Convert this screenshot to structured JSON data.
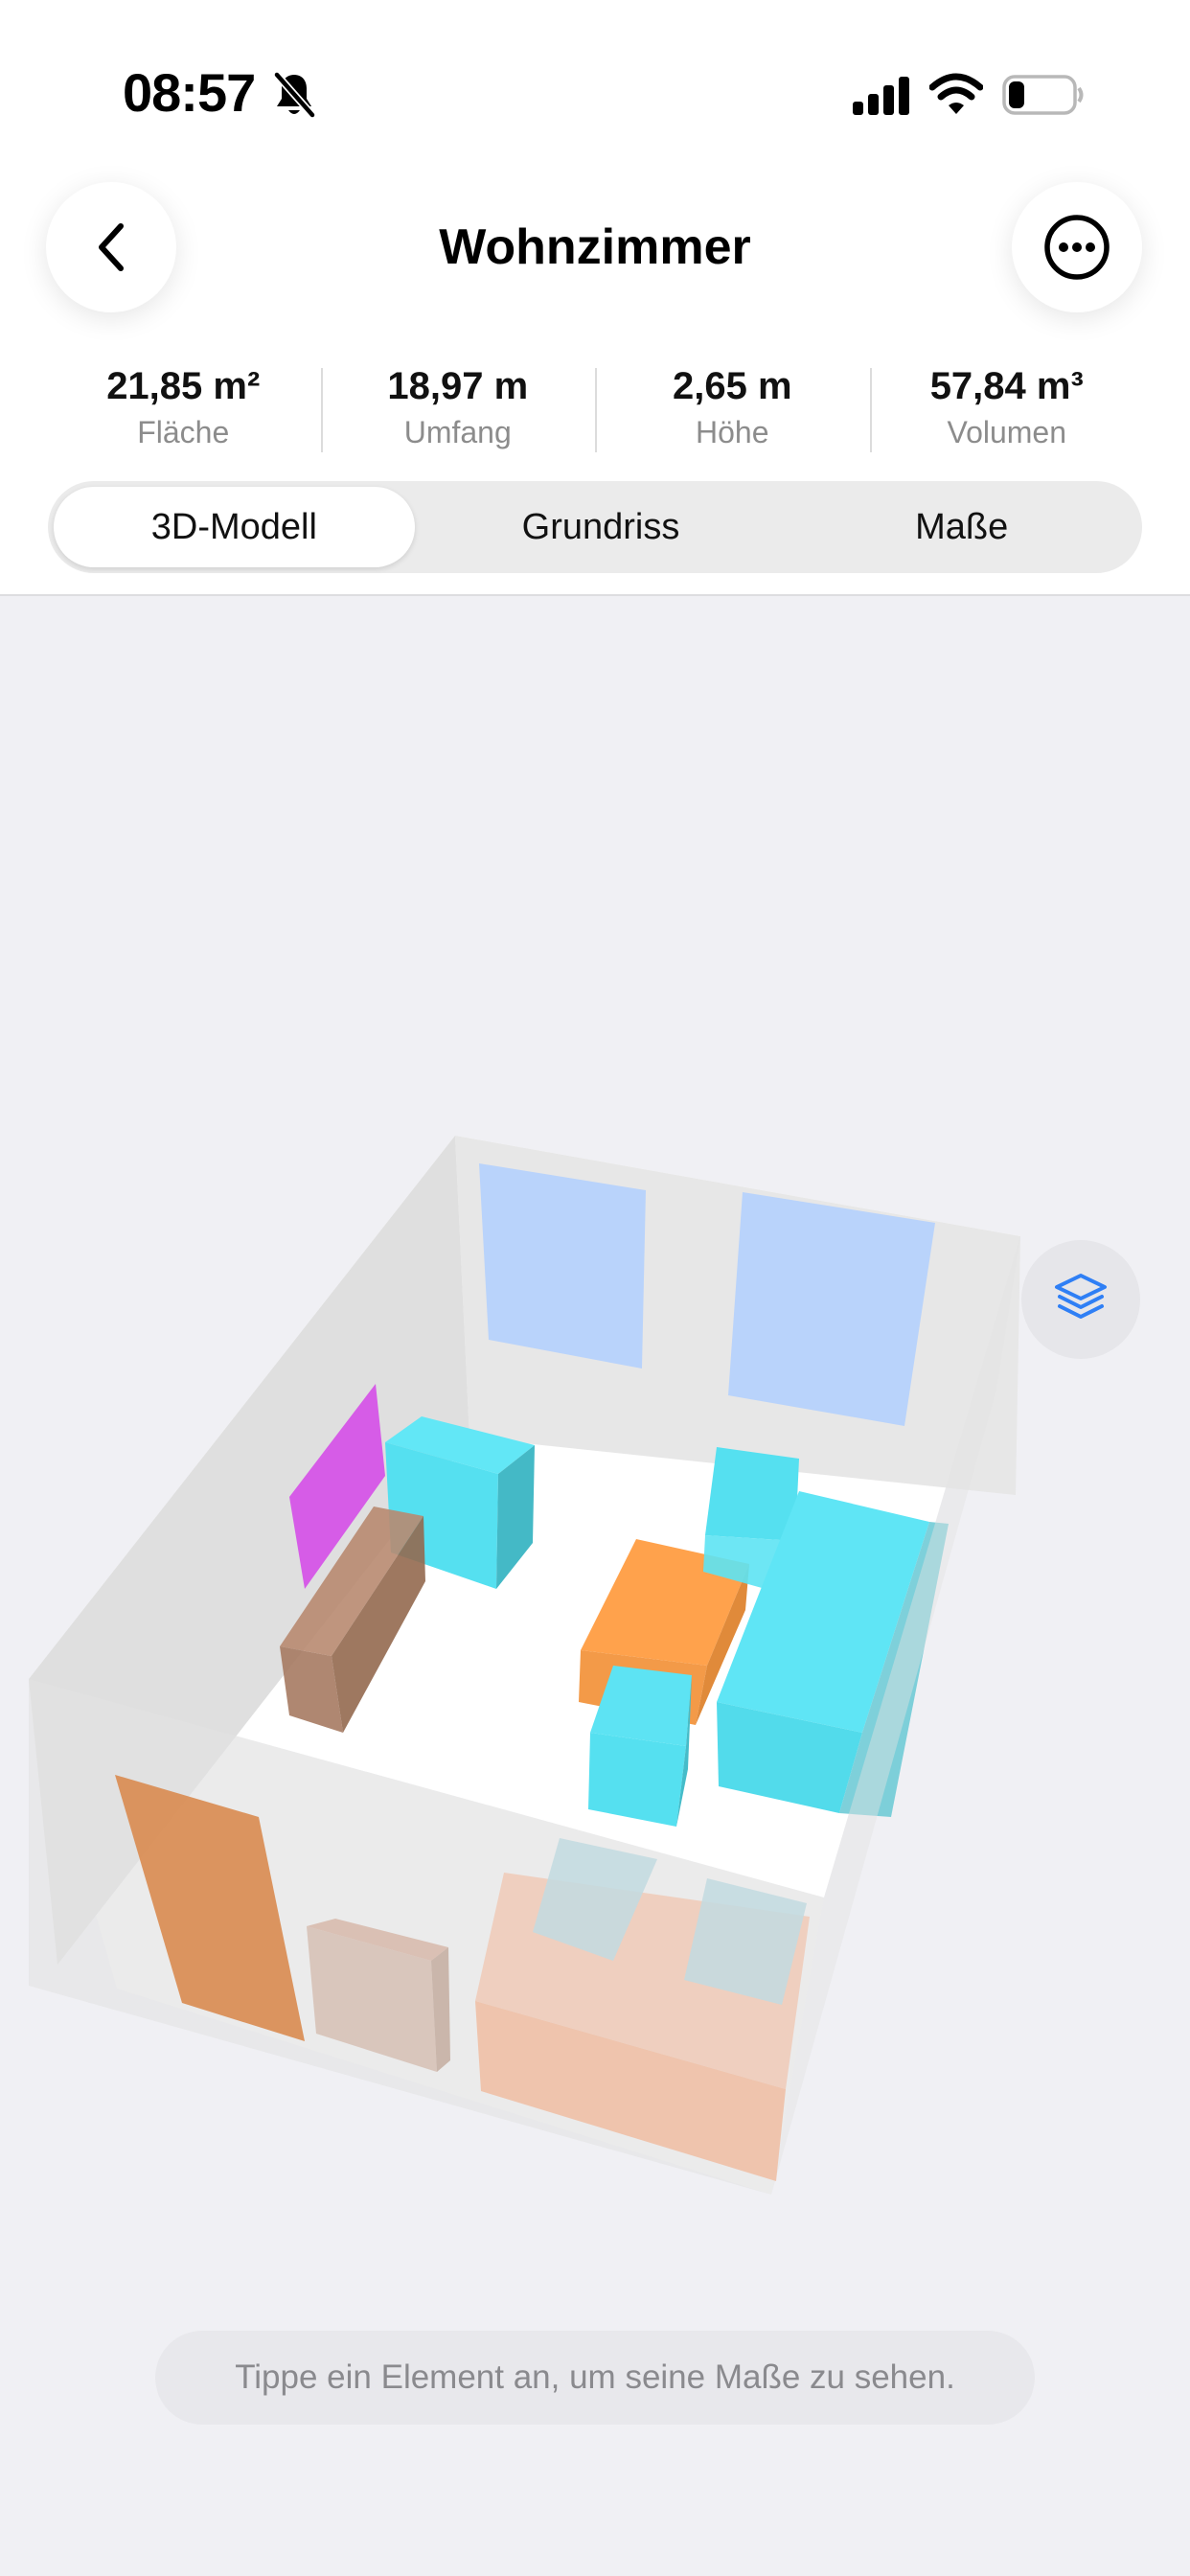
{
  "status_bar": {
    "time": "08:57",
    "mute_icon": "bell-slash-icon",
    "signal_icon": "cellular-signal-icon",
    "wifi_icon": "wifi-icon",
    "battery_icon": "battery-icon",
    "battery_level": 0.25
  },
  "header": {
    "title": "Wohnzimmer",
    "back_icon": "chevron-left-icon",
    "more_icon": "ellipsis-circle-icon"
  },
  "stats": [
    {
      "value": "21,85 m²",
      "label": "Fläche"
    },
    {
      "value": "18,97 m",
      "label": "Umfang"
    },
    {
      "value": "2,65 m",
      "label": "Höhe"
    },
    {
      "value": "57,84 m³",
      "label": "Volumen"
    }
  ],
  "tabs": [
    {
      "label": "3D-Modell",
      "selected": true
    },
    {
      "label": "Grundriss",
      "selected": false
    },
    {
      "label": "Maße",
      "selected": false
    }
  ],
  "viewport": {
    "layers_icon": "layers-icon",
    "hint": "Tippe ein Element an, um seine Maße zu sehen."
  },
  "colors": {
    "accent": "#2f7ff5",
    "background": "#f0f0f4",
    "furniture_cyan": "#4fe3f5",
    "furniture_orange": "#ffa24c",
    "tv_magenta": "#d54ee8",
    "window_blue": "#b9d3fb"
  }
}
